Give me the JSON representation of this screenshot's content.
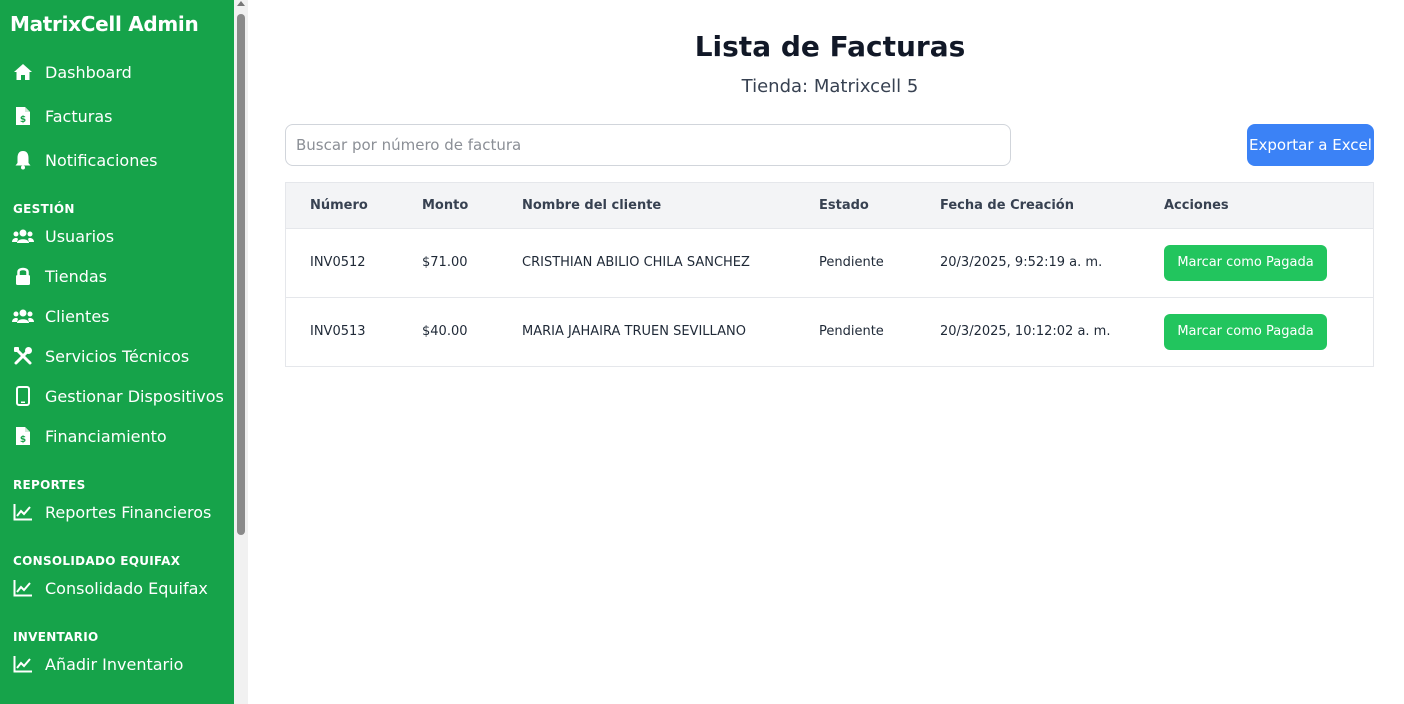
{
  "sidebar": {
    "brand": "MatrixCell Admin",
    "items": [
      {
        "label": "Dashboard",
        "icon": "home-icon"
      },
      {
        "label": "Facturas",
        "icon": "invoice-icon"
      },
      {
        "label": "Notificaciones",
        "icon": "bell-icon"
      },
      {
        "label": "Usuarios",
        "icon": "users-icon"
      },
      {
        "label": "Tiendas",
        "icon": "lock-icon"
      },
      {
        "label": "Clientes",
        "icon": "clients-icon"
      },
      {
        "label": "Servicios Técnicos",
        "icon": "tools-icon"
      },
      {
        "label": "Gestionar Dispositivos",
        "icon": "mobile-icon"
      },
      {
        "label": "Financiamiento",
        "icon": "invoice-icon"
      },
      {
        "label": "Reportes Financieros",
        "icon": "chart-line-icon"
      },
      {
        "label": "Consolidado Equifax",
        "icon": "chart-line-icon"
      },
      {
        "label": "Añadir Inventario",
        "icon": "chart-line-icon"
      }
    ],
    "sections": [
      "GESTIÓN",
      "REPORTES",
      "CONSOLIDADO EQUIFAX",
      "INVENTARIO"
    ]
  },
  "main": {
    "title": "Lista de Facturas",
    "subtitle": "Tienda: Matrixcell 5",
    "search_placeholder": "Buscar por número de factura",
    "export_label": "Exportar a Excel",
    "table": {
      "headers": [
        "Número",
        "Monto",
        "Nombre del cliente",
        "Estado",
        "Fecha de Creación",
        "Acciones"
      ],
      "rows": [
        {
          "numero": "INV0512",
          "monto": "$71.00",
          "cliente": "CRISTHIAN ABILIO CHILA SANCHEZ",
          "estado": "Pendiente",
          "fecha": "20/3/2025, 9:52:19 a. m.",
          "accion": "Marcar como Pagada"
        },
        {
          "numero": "INV0513",
          "monto": "$40.00",
          "cliente": "MARIA JAHAIRA TRUEN SEVILLANO",
          "estado": "Pendiente",
          "fecha": "20/3/2025, 10:12:02 a. m.",
          "accion": "Marcar como Pagada"
        }
      ]
    }
  },
  "colors": {
    "sidebar_bg": "#16a34a",
    "export_button": "#3b82f6",
    "pay_button": "#22c55e"
  }
}
